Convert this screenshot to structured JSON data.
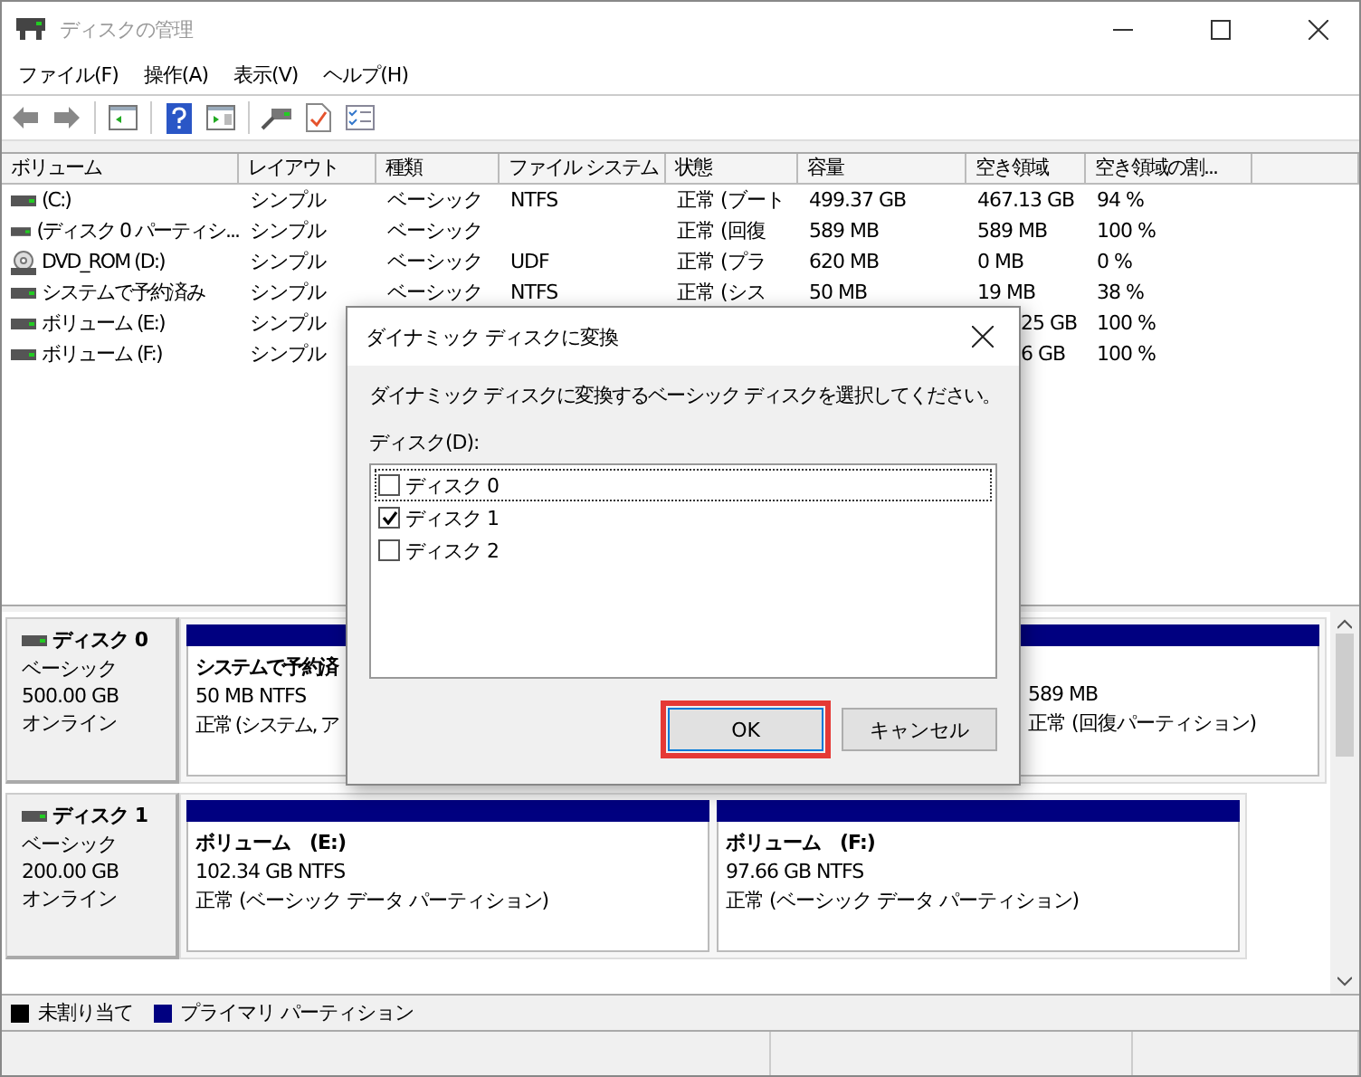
{
  "window": {
    "title": "ディスクの管理"
  },
  "menu": [
    "ファイル(F)",
    "操作(A)",
    "表示(V)",
    "ヘルプ(H)"
  ],
  "toolbar": [
    {
      "kind": "back"
    },
    {
      "kind": "forward"
    },
    {
      "kind": "tree"
    },
    {
      "kind": "help"
    },
    {
      "kind": "pane"
    },
    {
      "kind": "connect"
    },
    {
      "kind": "properties"
    },
    {
      "kind": "checklist"
    }
  ],
  "volume_table": {
    "columns": [
      "ボリューム",
      "レイアウト",
      "種類",
      "ファイル システム",
      "状態",
      "容量",
      "空き領域",
      "空き領域の割..."
    ],
    "rows": [
      {
        "kind": "drive",
        "cells": [
          "(C:)",
          "シンプル",
          "ベーシック",
          "NTFS",
          "正常 (ブート",
          "499.37 GB",
          "467.13 GB",
          "94 %"
        ]
      },
      {
        "kind": "drive",
        "cells": [
          "(ディスク 0 パーティシ...",
          "シンプル",
          "ベーシック",
          null,
          "正常 (回復",
          "589 MB",
          "589 MB",
          "100 %"
        ]
      },
      {
        "kind": "dvd",
        "cells": [
          "DVD_ROM (D:)",
          "シンプル",
          "ベーシック",
          "UDF",
          "正常 (プラ",
          "620 MB",
          "0 MB",
          "0 %"
        ]
      },
      {
        "kind": "drive",
        "cells": [
          "システムで予約済み",
          "シンプル",
          "ベーシック",
          "NTFS",
          "正常 (シス",
          "50 MB",
          "19 MB",
          "38 %"
        ]
      },
      {
        "kind": "drive",
        "cells": [
          "ボリューム (E:)",
          "シンプル",
          null,
          null,
          null,
          null,
          "25 GB",
          "100 %"
        ]
      },
      {
        "kind": "drive",
        "cells": [
          "ボリューム (F:)",
          "シンプル",
          null,
          null,
          null,
          null,
          "6 GB",
          "100 %"
        ]
      }
    ]
  },
  "disks": [
    {
      "name": "ディスク 0",
      "type": "ベーシック",
      "size": "500.00 GB",
      "status": "オンライン",
      "partitions": [
        {
          "title": "システムで予約済",
          "size": "50 MB NTFS",
          "status": "正常 (システム, ア"
        },
        {
          "size": "589 MB",
          "status": "正常 (回復パーティション)"
        }
      ]
    },
    {
      "name": "ディスク 1",
      "type": "ベーシック",
      "size": "200.00 GB",
      "status": "オンライン",
      "partitions": [
        {
          "title": "ボリューム　(E:)",
          "size": "102.34 GB NTFS",
          "status": "正常 (ベーシック データ パーティション)"
        },
        {
          "title": "ボリューム　(F:)",
          "size": "97.66 GB NTFS",
          "status": "正常 (ベーシック データ パーティション)"
        }
      ]
    }
  ],
  "legend": [
    {
      "label": "未割り当て",
      "color": "#000000"
    },
    {
      "label": "プライマリ パーティション",
      "color": "#000080"
    }
  ],
  "dialog": {
    "title": "ダイナミック ディスクに変換",
    "instruction": "ダイナミック ディスクに変換するベーシック ディスクを選択してください。",
    "list_label": "ディスク(D):",
    "items": [
      {
        "label": "ディスク 0",
        "checked": false,
        "focused": true
      },
      {
        "label": "ディスク 1",
        "checked": true,
        "focused": false
      },
      {
        "label": "ディスク 2",
        "checked": false,
        "focused": false
      }
    ],
    "buttons": [
      {
        "label": "OK",
        "default": true,
        "highlighted": true
      },
      {
        "label": "キャンセル",
        "default": false,
        "highlighted": false
      }
    ]
  }
}
